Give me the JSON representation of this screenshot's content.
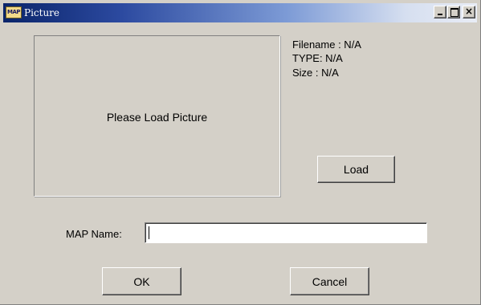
{
  "window": {
    "title": "Picture",
    "icon_label": "MAP",
    "controls": {
      "minimize_icon": "minimize-icon",
      "maximize_icon": "maximize-icon",
      "close_icon": "close-icon",
      "close_glyph": "×"
    },
    "colors": {
      "face": "#d4d0c8",
      "titlebar_start": "#0a246a",
      "titlebar_end": "#e8ecf5"
    }
  },
  "preview": {
    "placeholder": "Please Load Picture"
  },
  "file_info": {
    "filename": "Filename : N/A",
    "type": "TYPE:  N/A",
    "size": "Size :  N/A"
  },
  "buttons": {
    "load": "Load",
    "ok": "OK",
    "cancel": "Cancel"
  },
  "map_name": {
    "label": "MAP  Name:",
    "value": ""
  }
}
